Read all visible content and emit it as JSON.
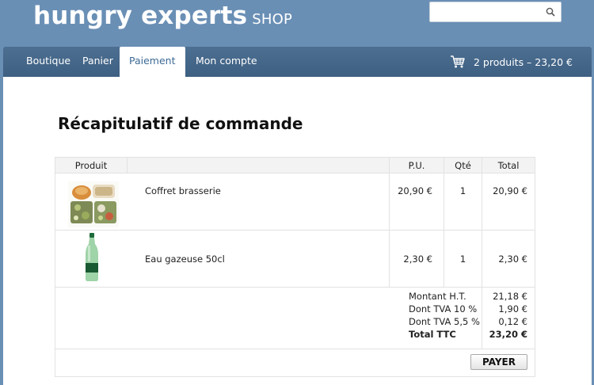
{
  "brand": {
    "name": "hungry experts",
    "suffix": "SHOP"
  },
  "search": {
    "placeholder": "",
    "value": "",
    "icon": "search-icon"
  },
  "nav": {
    "items": [
      {
        "label": "Boutique"
      },
      {
        "label": "Panier"
      },
      {
        "label": "Paiement",
        "active": true
      },
      {
        "label": "Mon compte"
      }
    ],
    "cart_summary": "2 produits – 23,20 €",
    "cart_icon": "shopping-cart-icon"
  },
  "page": {
    "title": "Récapitulatif de commande"
  },
  "table": {
    "headers": {
      "product": "Produit",
      "unit_price": "P.U.",
      "qty": "Qté",
      "total": "Total"
    },
    "rows": [
      {
        "name": "Coffret brasserie",
        "unit_price": "20,90 €",
        "qty": "1",
        "total": "20,90 €",
        "image": "meal-box-image"
      },
      {
        "name": "Eau gazeuse 50cl",
        "unit_price": "2,30 €",
        "qty": "1",
        "total": "2,30 €",
        "image": "water-bottle-image"
      }
    ]
  },
  "summary": {
    "ht_label": "Montant H.T.",
    "ht_value": "21,18 €",
    "tva10_label": "Dont TVA 10 %",
    "tva10_value": "1,90 €",
    "tva55_label": "Dont TVA 5,5 %",
    "tva55_value": "0,12 €",
    "ttc_label": "Total TTC",
    "ttc_value": "23,20 €"
  },
  "actions": {
    "pay_label": "PAYER"
  },
  "colors": {
    "header_bg": "#6a8fb5",
    "nav_bg": "#456889",
    "active_tab_text": "#3d6a96"
  }
}
